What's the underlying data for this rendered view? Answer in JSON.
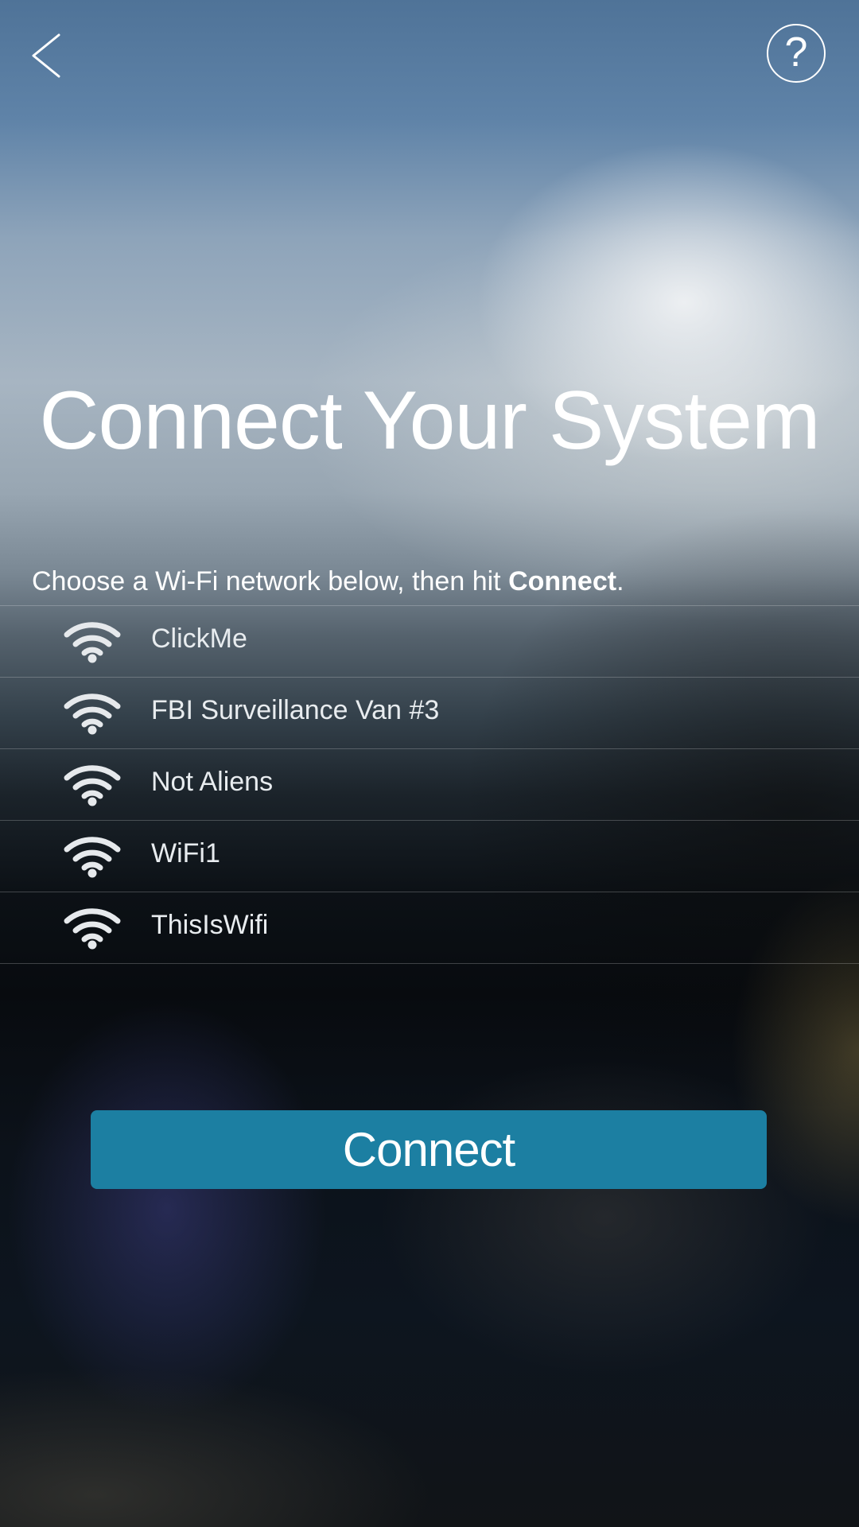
{
  "header": {
    "back_icon": "chevron-left-icon",
    "help_icon": "question-circle-icon",
    "help_glyph": "?"
  },
  "title": "Connect Your System",
  "instructions": {
    "prefix": "Choose a Wi-Fi network below, then hit ",
    "bold": "Connect",
    "suffix": "."
  },
  "networks": [
    {
      "name": "ClickMe",
      "icon": "wifi-icon"
    },
    {
      "name": "FBI Surveillance Van #3",
      "icon": "wifi-icon"
    },
    {
      "name": "Not Aliens",
      "icon": "wifi-icon"
    },
    {
      "name": "WiFi1",
      "icon": "wifi-icon"
    },
    {
      "name": "ThisIsWifi",
      "icon": "wifi-icon"
    }
  ],
  "connect_button": {
    "label": "Connect"
  },
  "colors": {
    "button": "#1c7fa2",
    "text": "#ffffff"
  }
}
